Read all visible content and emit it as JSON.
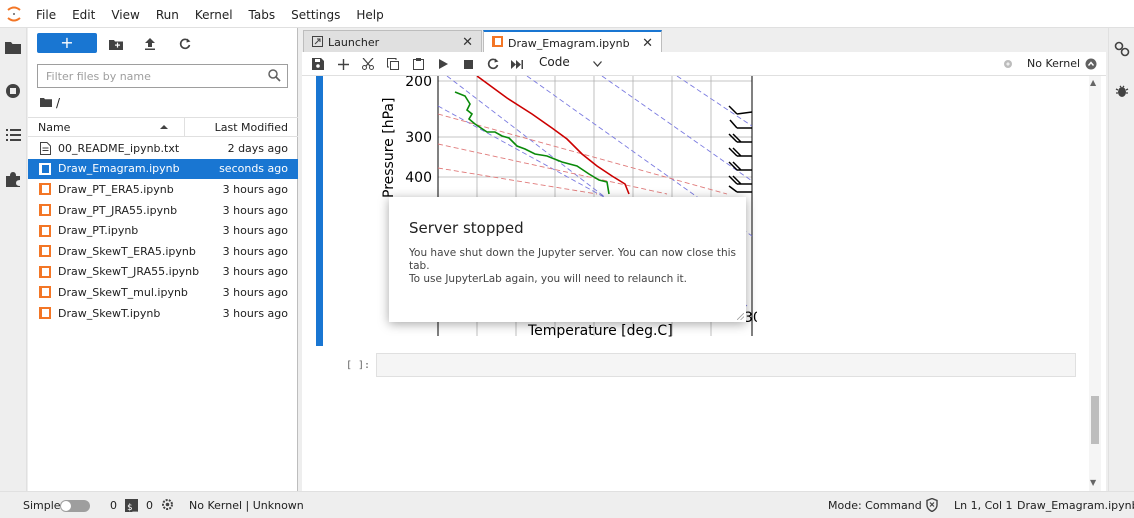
{
  "menu": [
    "File",
    "Edit",
    "View",
    "Run",
    "Kernel",
    "Tabs",
    "Settings",
    "Help"
  ],
  "filebrowser": {
    "new_label": "+",
    "filter_placeholder": "Filter files by name",
    "path": "/",
    "col_name": "Name",
    "col_modified": "Last Modified",
    "files": [
      {
        "name": "00_README_ipynb.txt",
        "modified": "2 days ago",
        "type": "text"
      },
      {
        "name": "Draw_Emagram.ipynb",
        "modified": "seconds ago",
        "type": "notebook",
        "selected": true
      },
      {
        "name": "Draw_PT_ERA5.ipynb",
        "modified": "3 hours ago",
        "type": "notebook"
      },
      {
        "name": "Draw_PT_JRA55.ipynb",
        "modified": "3 hours ago",
        "type": "notebook"
      },
      {
        "name": "Draw_PT.ipynb",
        "modified": "3 hours ago",
        "type": "notebook"
      },
      {
        "name": "Draw_SkewT_ERA5.ipynb",
        "modified": "3 hours ago",
        "type": "notebook"
      },
      {
        "name": "Draw_SkewT_JRA55.ipynb",
        "modified": "3 hours ago",
        "type": "notebook"
      },
      {
        "name": "Draw_SkewT_mul.ipynb",
        "modified": "3 hours ago",
        "type": "notebook"
      },
      {
        "name": "Draw_SkewT.ipynb",
        "modified": "3 hours ago",
        "type": "notebook"
      }
    ]
  },
  "tabs": [
    {
      "label": "Launcher",
      "active": false
    },
    {
      "label": "Draw_Emagram.ipynb",
      "active": true
    }
  ],
  "notebook": {
    "cell_type": "Code",
    "kernel": "No Kernel",
    "prompt": "[ ]:",
    "plot": {
      "ylabel": "Pressure [hPa]",
      "xlabel": "Temperature [deg.C]",
      "yticks": [
        "200",
        "300",
        "400"
      ],
      "xtick_partial": "30"
    }
  },
  "statusbar": {
    "mode_label": "Simple",
    "terminals": "0",
    "kernels": "0",
    "kernel_status": "No Kernel | Unknown",
    "mode": "Mode: Command",
    "position": "Ln 1, Col 1",
    "file": "Draw_Emagram.ipynb"
  },
  "dialog": {
    "title": "Server stopped",
    "line1": "You have shut down the Jupyter server. You can now close this tab.",
    "line2": "To use JupyterLab again, you will need to relaunch it."
  },
  "colors": {
    "accent": "#1976d2",
    "notebook_icon": "#f37626"
  }
}
